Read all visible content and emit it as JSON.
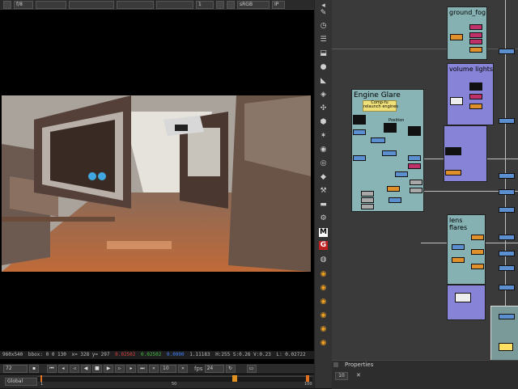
{
  "viewer": {
    "toolbar": {
      "input": "f/8",
      "frame_field": "1",
      "colorspace": "sRGB",
      "ip_label": "IP"
    },
    "info": {
      "format": "960x540",
      "bbox": "bbox: 0 0 130",
      "coords": "x= 328 y= 297",
      "r": "0.02502",
      "g": "0.02502",
      "b": "0.0000",
      "a": "1.11183",
      "hsv": "H:255 S:0.26 V:0.23",
      "l": "L: 0.02722"
    },
    "transport": {
      "frame": "72",
      "step": "10",
      "fps_label": "fps",
      "fps_value": "24"
    },
    "timeline": {
      "range_mode": "Global",
      "ticks": [
        "1",
        "50",
        "100"
      ]
    }
  },
  "toolbar_icons": [
    "pointer-icon",
    "paint-icon",
    "clock-icon",
    "layers-icon",
    "channel-icon",
    "color-icon",
    "filter-icon",
    "keyer-icon",
    "merge-icon",
    "transform-icon",
    "3d-icon",
    "particles-icon",
    "deep-icon",
    "views-icon",
    "metadata-icon",
    "toolsets-icon",
    "other-icon",
    "gizmo-icon",
    "m-icon",
    "g-icon",
    "plugin-icon",
    "orange-tool-1",
    "orange-tool-2",
    "orange-tool-3",
    "orange-tool-4",
    "orange-tool-5"
  ],
  "node_graph": {
    "backdrops": [
      {
        "label": "ground_fog",
        "color": "#86b1b3"
      },
      {
        "label": "volume lights",
        "color": "#8784d8"
      },
      {
        "label": "Engine Glare",
        "color": "#88b4b5"
      },
      {
        "label": "lens\nflares",
        "color": "#86b1b3"
      }
    ],
    "sticky_note": "Comp-fu\nrelaunch engines",
    "position_label": "Position"
  },
  "properties": {
    "title": "Properties",
    "max_panels": "10"
  }
}
